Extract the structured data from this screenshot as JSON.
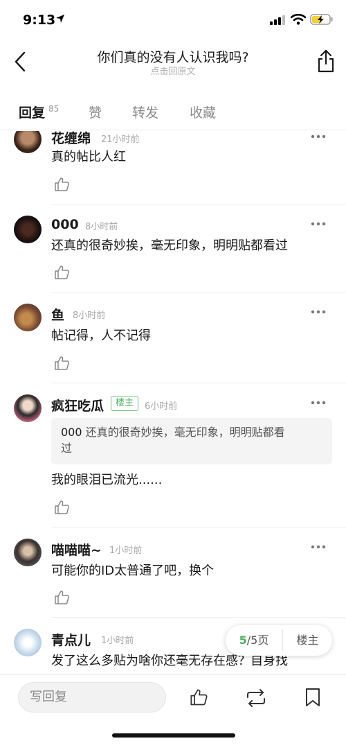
{
  "status_bar": {
    "time": "9:13"
  },
  "header": {
    "title": "你们真的没有人认识我吗?",
    "subtitle": "点击回原文"
  },
  "tabs": [
    {
      "label": "回复",
      "count": "85",
      "active": true
    },
    {
      "label": "赞"
    },
    {
      "label": "转发"
    },
    {
      "label": "收藏"
    }
  ],
  "comments": [
    {
      "user": "花缠绵",
      "time": "21小时前",
      "text": "真的帖比人红"
    },
    {
      "user": "000",
      "time": "8小时前",
      "text": "还真的很奇妙挨，毫无印象，明明贴都看过"
    },
    {
      "user": "鱼",
      "time": "8小时前",
      "text": "帖记得，人不记得"
    },
    {
      "user": "疯狂吃瓜",
      "badge": "楼主",
      "time": "6小时前",
      "quote_user": "000",
      "quote_line1": "还真的很奇妙挨，毫无印象，明明贴都看",
      "quote_line2": "过",
      "text": "我的眼泪已流光......"
    },
    {
      "user": "喵喵喵~",
      "time": "1小时前",
      "text": "可能你的ID太普通了吧，换个"
    },
    {
      "user": "青点儿",
      "time": "1小时前",
      "text": "发了这么多贴为啥你还毫无存在感？自身找"
    }
  ],
  "pager": {
    "current": "5",
    "total_text": "/5页",
    "op_label": "楼主"
  },
  "bottom_bar": {
    "reply_placeholder": "写回复"
  },
  "colors": {
    "accent": "#4fae5e",
    "text": "#1a1a1a",
    "muted": "#a8a8a8"
  }
}
